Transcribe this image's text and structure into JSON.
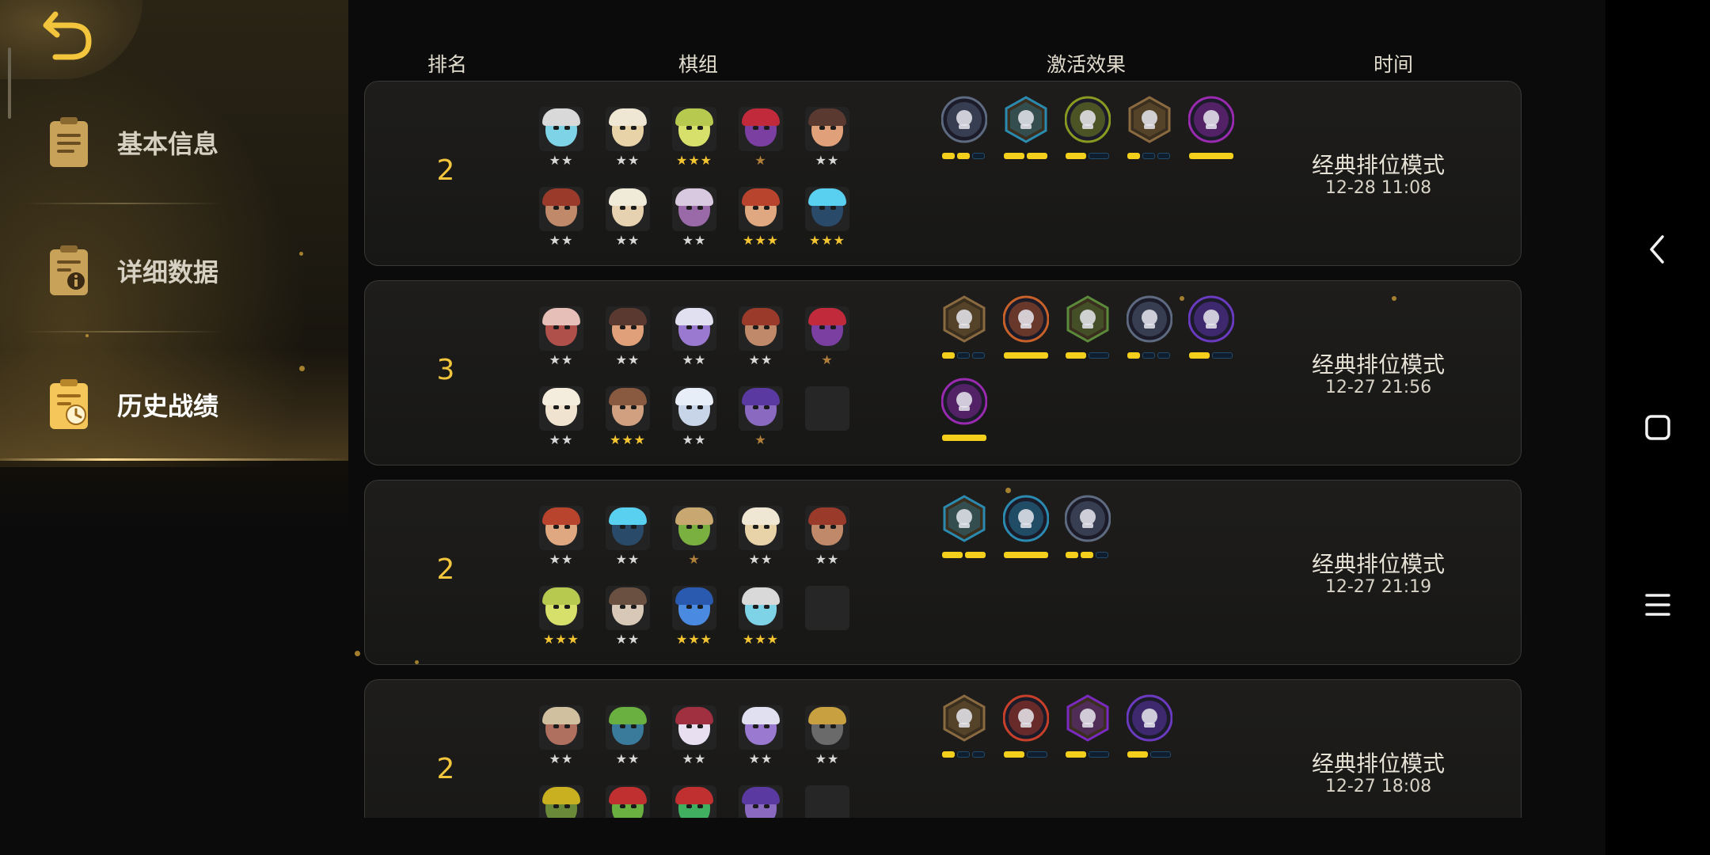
{
  "sidebar": {
    "items": [
      {
        "label": "基本信息",
        "icon": "document-icon"
      },
      {
        "label": "详细数据",
        "icon": "document-info-icon"
      },
      {
        "label": "历史战绩",
        "icon": "history-clock-icon",
        "active": true
      }
    ]
  },
  "headers": {
    "rank": "排名",
    "lineup": "棋组",
    "effects": "激活效果",
    "time": "时间"
  },
  "records": [
    {
      "rank": "2",
      "mode": "经典排位模式",
      "time": "12-28 11:08",
      "units": [
        {
          "stars": 2,
          "hue": "#7fd3e6",
          "hair": "#d9d9d9"
        },
        {
          "stars": 2,
          "hue": "#e8d2a8",
          "hair": "#efe6d4"
        },
        {
          "stars": 3,
          "hue": "#d6e06a",
          "hair": "#b8c950"
        },
        {
          "stars": 1,
          "hue": "#7a3fa0",
          "hair": "#c02a3a"
        },
        {
          "stars": 2,
          "hue": "#e0a07a",
          "hair": "#5a3a30"
        },
        {
          "stars": 2,
          "hue": "#c08a6a",
          "hair": "#9a3a2a"
        },
        {
          "stars": 2,
          "hue": "#e6d2b0",
          "hair": "#f0ead8"
        },
        {
          "stars": 2,
          "hue": "#9a6aa8",
          "hair": "#d8c8e0"
        },
        {
          "stars": 3,
          "hue": "#e0a880",
          "hair": "#b8442e"
        },
        {
          "stars": 3,
          "hue": "#2a4a6a",
          "hair": "#5ad0f0"
        }
      ],
      "traits": [
        {
          "icon": "helmet-icon",
          "shape": "circle",
          "color": "#5d6a80",
          "bars": [
            1,
            1,
            0
          ]
        },
        {
          "icon": "mage-staff-icon",
          "shape": "hex",
          "color": "#2a8ab0",
          "bars": [
            1,
            1
          ]
        },
        {
          "icon": "cluster-icon",
          "shape": "circle",
          "color": "#8a9a20",
          "bars": [
            1,
            0
          ]
        },
        {
          "icon": "axe-icon",
          "shape": "hex",
          "color": "#8a6a40",
          "bars": [
            1,
            0,
            0
          ]
        },
        {
          "icon": "demon-skull-icon",
          "shape": "circle",
          "color": "#9a2ab0",
          "bars": [
            1
          ]
        }
      ]
    },
    {
      "rank": "3",
      "mode": "经典排位模式",
      "time": "12-27 21:56",
      "units": [
        {
          "stars": 2,
          "hue": "#b0504a",
          "hair": "#e6c0b8"
        },
        {
          "stars": 2,
          "hue": "#e0a07a",
          "hair": "#5a3a30"
        },
        {
          "stars": 2,
          "hue": "#9a7ad0",
          "hair": "#e0e0f0"
        },
        {
          "stars": 2,
          "hue": "#c08a6a",
          "hair": "#9a3a2a"
        },
        {
          "stars": 1,
          "hue": "#7a3fa0",
          "hair": "#c02a3a"
        },
        {
          "stars": 2,
          "hue": "#f0e4d0",
          "hair": "#f4ecdc"
        },
        {
          "stars": 3,
          "hue": "#d0a080",
          "hair": "#8a5a40"
        },
        {
          "stars": 2,
          "hue": "#c8d4e8",
          "hair": "#e8eef8"
        },
        {
          "stars": 1,
          "hue": "#8a6ac0",
          "hair": "#5a3aa0"
        },
        {
          "stars": 0,
          "empty": true
        }
      ],
      "traits": [
        {
          "icon": "axe-icon",
          "shape": "hex",
          "color": "#8a6a40",
          "bars": [
            1,
            0,
            0
          ]
        },
        {
          "icon": "horned-helm-icon",
          "shape": "circle",
          "color": "#c8602a",
          "bars": [
            1
          ]
        },
        {
          "icon": "bow-icon",
          "shape": "hex",
          "color": "#5a8a3a",
          "bars": [
            1,
            0
          ]
        },
        {
          "icon": "helmet-icon",
          "shape": "circle",
          "color": "#5d6a80",
          "bars": [
            1,
            0,
            0
          ]
        },
        {
          "icon": "fish-bone-icon",
          "shape": "circle",
          "color": "#6a3ac0",
          "bars": [
            1,
            0
          ]
        },
        {
          "icon": "demon-skull-icon",
          "shape": "circle",
          "color": "#9a2ab0",
          "bars": [
            1
          ]
        }
      ]
    },
    {
      "rank": "2",
      "mode": "经典排位模式",
      "time": "12-27 21:19",
      "units": [
        {
          "stars": 2,
          "hue": "#e0a880",
          "hair": "#b8442e"
        },
        {
          "stars": 2,
          "hue": "#2a4a6a",
          "hair": "#5ad0f0"
        },
        {
          "stars": 1,
          "hue": "#7ab040",
          "hair": "#c8a870"
        },
        {
          "stars": 2,
          "hue": "#e8d2a8",
          "hair": "#efe6d4"
        },
        {
          "stars": 2,
          "hue": "#c08a6a",
          "hair": "#9a3a2a"
        },
        {
          "stars": 3,
          "hue": "#d6e06a",
          "hair": "#b8c950"
        },
        {
          "stars": 2,
          "hue": "#d8c8b8",
          "hair": "#6a5040"
        },
        {
          "stars": 3,
          "hue": "#4a8ae0",
          "hair": "#2a5ab0"
        },
        {
          "stars": 3,
          "hue": "#7fd3e6",
          "hair": "#d9d9d9"
        },
        {
          "stars": 0,
          "empty": true
        }
      ],
      "traits": [
        {
          "icon": "mage-staff-icon",
          "shape": "hex",
          "color": "#2a8ab0",
          "bars": [
            1,
            1
          ]
        },
        {
          "icon": "pumpkin-icon",
          "shape": "circle",
          "color": "#2a8ab0",
          "bars": [
            1
          ]
        },
        {
          "icon": "helmet-icon",
          "shape": "circle",
          "color": "#5d6a80",
          "bars": [
            1,
            1,
            0
          ]
        }
      ]
    },
    {
      "rank": "2",
      "mode": "经典排位模式",
      "time": "12-27 18:08",
      "units": [
        {
          "stars": 2,
          "hue": "#b07060",
          "hair": "#d0c0a0"
        },
        {
          "stars": 2,
          "hue": "#3a7a9a",
          "hair": "#6ab040"
        },
        {
          "stars": 2,
          "hue": "#e8e0f0",
          "hair": "#a03040"
        },
        {
          "stars": 2,
          "hue": "#9a7ad0",
          "hair": "#e0e0f0"
        },
        {
          "stars": 2,
          "hue": "#6a6a6a",
          "hair": "#c8a040"
        },
        {
          "stars": 0,
          "hue": "#6a8a3a",
          "hair": "#c8b020"
        },
        {
          "stars": 0,
          "hue": "#6ab040",
          "hair": "#c03030"
        },
        {
          "stars": 0,
          "hue": "#40b060",
          "hair": "#c03030"
        },
        {
          "stars": 0,
          "hue": "#8a6ac0",
          "hair": "#5a3aa0"
        },
        {
          "stars": 0,
          "empty": true
        }
      ],
      "traits": [
        {
          "icon": "gear-icon",
          "shape": "hex",
          "color": "#8a6a40",
          "bars": [
            1,
            0,
            0
          ]
        },
        {
          "icon": "bull-icon",
          "shape": "circle",
          "color": "#c8402a",
          "bars": [
            1,
            0
          ]
        },
        {
          "icon": "spirit-icon",
          "shape": "hex",
          "color": "#7a2ac0",
          "bars": [
            1,
            0
          ]
        },
        {
          "icon": "fish-bone-icon",
          "shape": "circle",
          "color": "#6a3ac0",
          "bars": [
            1,
            0
          ]
        }
      ]
    }
  ],
  "nav": {
    "back": "back-arrow-icon",
    "home": "home-square-icon",
    "recents": "menu-lines-icon"
  }
}
